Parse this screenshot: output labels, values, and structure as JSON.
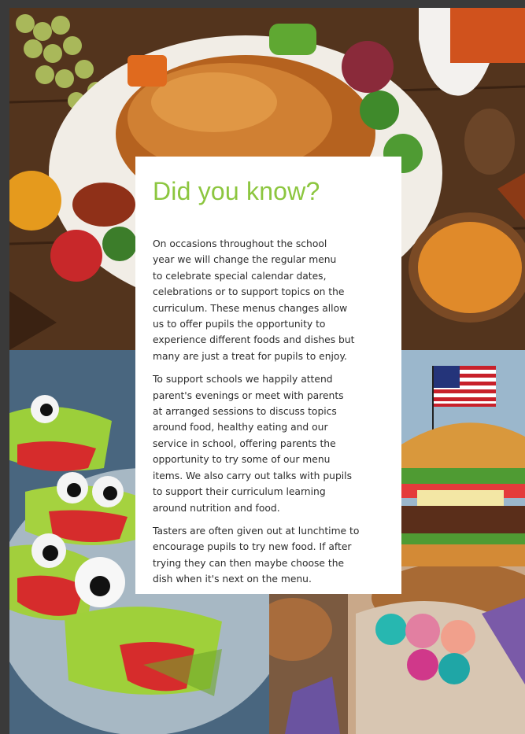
{
  "title": "Did you know?",
  "paragraphs": [
    "On occasions throughout the school\nyear we will change the regular menu\nto celebrate special calendar dates,\ncelebrations or to support topics on the\ncurriculum. These menus changes allow\nus to offer pupils the opportunity to\nexperience different foods and dishes but\nmany are just a treat for pupils to enjoy.",
    "To support schools we happily attend\nparent's evenings or meet with parents\nat arranged sessions to discuss topics\naround food, healthy eating and our\nservice in school, offering parents the\nopportunity to try some of our menu\nitems. We also carry out talks with pupils\nto support their curriculum learning\naround nutrition and food.",
    "Tasters are often given out at lunchtime to\nencourage pupils to try new food. If after\ntrying they can then maybe choose the\ndish when it's next on the menu."
  ],
  "colors": {
    "title": "#8cc63f",
    "body_text": "#2b2b2b",
    "panel": "#ffffff"
  }
}
